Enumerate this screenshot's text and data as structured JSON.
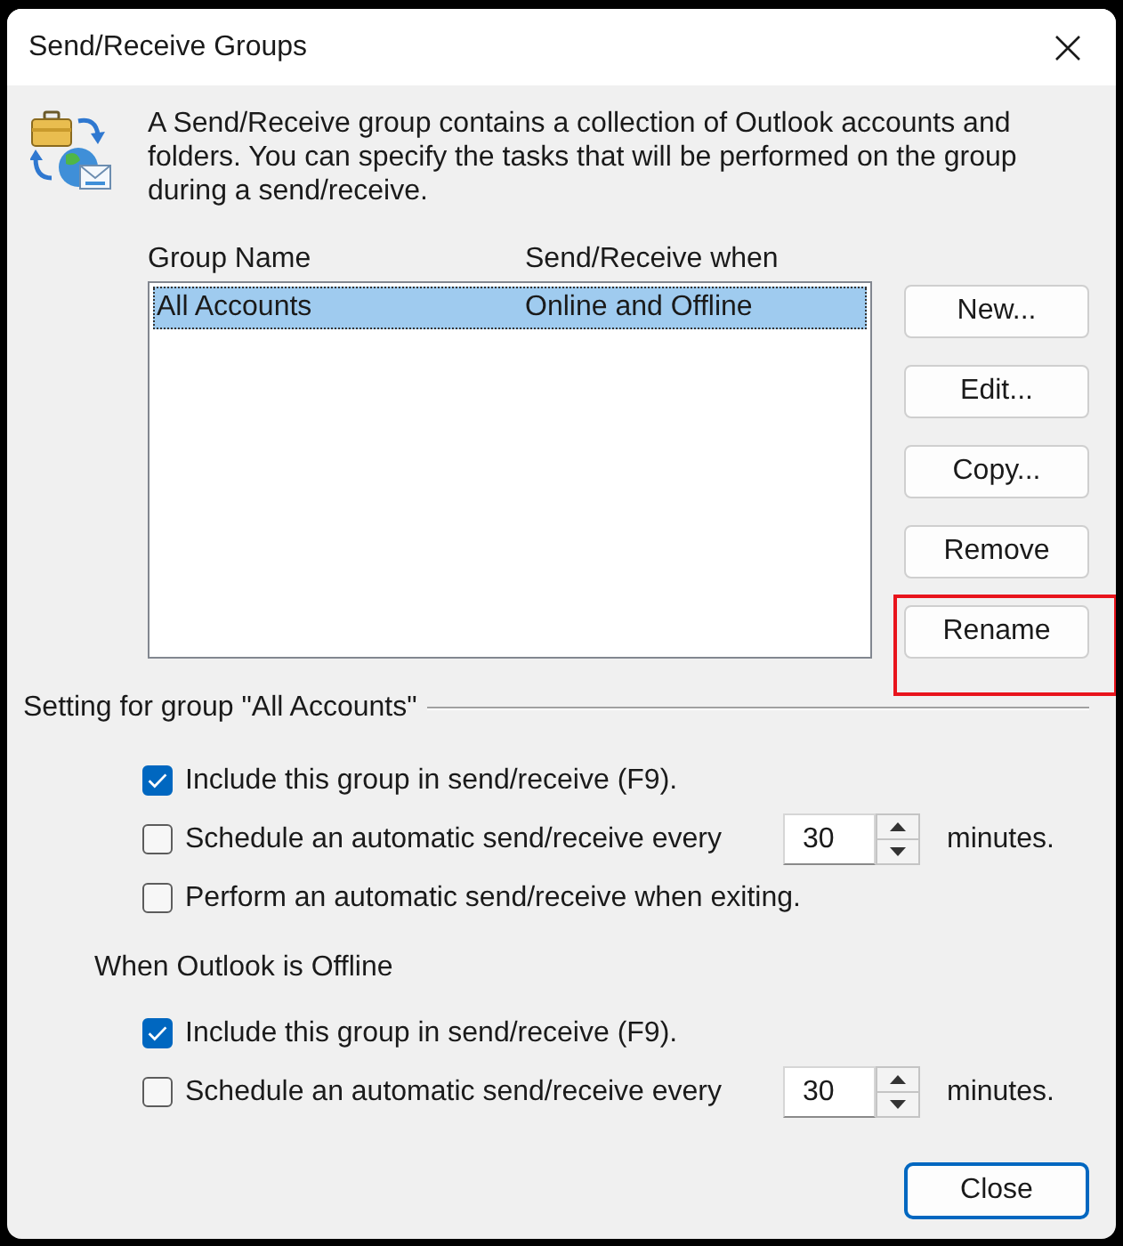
{
  "window": {
    "title": "Send/Receive Groups"
  },
  "description": "A Send/Receive group contains a collection of Outlook accounts and folders. You can specify the tasks that will be performed on the group during a send/receive.",
  "groups_list": {
    "columns": [
      "Group Name",
      "Send/Receive when"
    ],
    "rows": [
      {
        "cells": [
          "All Accounts",
          "Online and Offline"
        ],
        "selected": true
      }
    ]
  },
  "buttons": [
    {
      "label": "New...",
      "highlighted": false
    },
    {
      "label": "Edit...",
      "highlighted": false
    },
    {
      "label": "Copy...",
      "highlighted": false
    },
    {
      "label": "Remove",
      "highlighted": false
    },
    {
      "label": "Rename",
      "highlighted": true
    }
  ],
  "sections": [
    {
      "kind": "ruled",
      "title": "Setting for group \"All Accounts\"",
      "options": [
        {
          "kind": "checkbox",
          "label": "Include this group in send/receive (F9).",
          "checked": true
        },
        {
          "kind": "interval",
          "label": "Schedule an automatic send/receive every",
          "checked": false,
          "value": "30",
          "unit": "minutes."
        },
        {
          "kind": "checkbox",
          "label": "Perform an automatic send/receive when exiting.",
          "checked": false
        }
      ]
    },
    {
      "kind": "plain",
      "title": "When Outlook is Offline",
      "options": [
        {
          "kind": "checkbox",
          "label": "Include this group in send/receive (F9).",
          "checked": true
        },
        {
          "kind": "interval",
          "label": "Schedule an automatic send/receive every",
          "checked": false,
          "value": "30",
          "unit": "minutes."
        }
      ]
    }
  ],
  "close_button": {
    "label": "Close"
  }
}
